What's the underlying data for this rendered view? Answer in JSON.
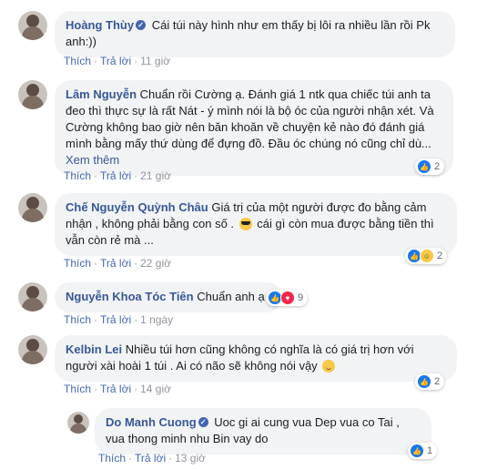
{
  "ui": {
    "like": "Thích",
    "reply": "Trả lời",
    "see_more": "Xem thêm"
  },
  "comments": [
    {
      "name": "Hoàng Thùy",
      "text": "Cái túi này hình như em thấy bị lôi ra nhiều lần rồi Pk anh:))",
      "time": "11 giờ",
      "verified": true
    },
    {
      "name": "Lâm Nguyễn",
      "text": "Chuẩn rồi Cường ạ. Đánh giá 1 ntk qua chiếc túi anh ta đeo thì thực sự là rất Nát - ý mình nói là bộ óc của người nhận xét. Và Cường không bao giờ nên băn khoăn về chuyện kẻ nào đó đánh giá mình bằng mấy thứ dùng để đựng đồ. Đầu óc chúng nó cũng chỉ dù...",
      "time": "21 giờ",
      "reactions": {
        "types": [
          "like"
        ],
        "count": "2"
      }
    },
    {
      "name": "Chế Nguyễn Quỳnh Châu",
      "text_a": "Giá trị của một người được đo bằng cảm nhận , không phải bằng con số .",
      "text_b": "cái gì còn mua được bằng tiền thì vẫn còn rẻ mà ...",
      "time": "22 giờ",
      "reactions": {
        "types": [
          "like",
          "haha"
        ],
        "count": "2"
      }
    },
    {
      "name": "Nguyễn Khoa Tóc Tiên",
      "text": "Chuẩn anh ạ",
      "time": "1 ngày",
      "reactions": {
        "types": [
          "like",
          "love"
        ],
        "count": "9"
      }
    },
    {
      "name": "Kelbin Lei",
      "text": "Nhiều túi hơn cũng không có nghĩa là có giá trị hơn với người xài hoài 1 túi . Ai có não sẽ không nói vậy",
      "time": "14 giờ",
      "reactions": {
        "types": [
          "like"
        ],
        "count": "2"
      }
    },
    {
      "name": "Do Manh Cuong",
      "text": "Uoc gi ai cung vua Dep vua co Tai , vua thong minh nhu Bin vay do",
      "time": "13 giờ",
      "verified": true,
      "reactions": {
        "types": [
          "like"
        ],
        "count": "1"
      }
    }
  ],
  "colors": {
    "name": "#385898",
    "bubble": "#f2f3f5",
    "link": "#4267b2",
    "meta": "#90949c",
    "like": "#1877f2",
    "love": "#f0284a",
    "haha": "#f7c948"
  }
}
